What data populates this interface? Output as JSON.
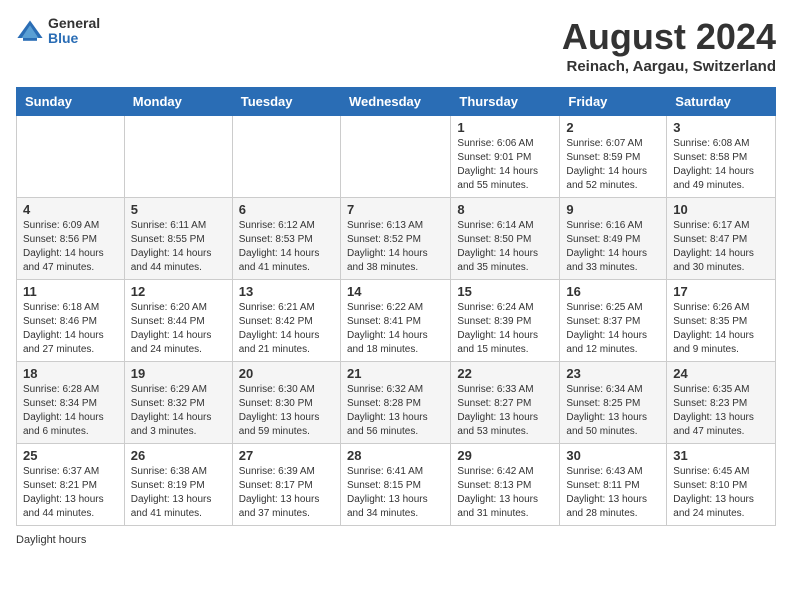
{
  "header": {
    "logo_general": "General",
    "logo_blue": "Blue",
    "month_year": "August 2024",
    "location": "Reinach, Aargau, Switzerland"
  },
  "weekdays": [
    "Sunday",
    "Monday",
    "Tuesday",
    "Wednesday",
    "Thursday",
    "Friday",
    "Saturday"
  ],
  "weeks": [
    [
      {
        "day": "",
        "info": ""
      },
      {
        "day": "",
        "info": ""
      },
      {
        "day": "",
        "info": ""
      },
      {
        "day": "",
        "info": ""
      },
      {
        "day": "1",
        "info": "Sunrise: 6:06 AM\nSunset: 9:01 PM\nDaylight: 14 hours\nand 55 minutes."
      },
      {
        "day": "2",
        "info": "Sunrise: 6:07 AM\nSunset: 8:59 PM\nDaylight: 14 hours\nand 52 minutes."
      },
      {
        "day": "3",
        "info": "Sunrise: 6:08 AM\nSunset: 8:58 PM\nDaylight: 14 hours\nand 49 minutes."
      }
    ],
    [
      {
        "day": "4",
        "info": "Sunrise: 6:09 AM\nSunset: 8:56 PM\nDaylight: 14 hours\nand 47 minutes."
      },
      {
        "day": "5",
        "info": "Sunrise: 6:11 AM\nSunset: 8:55 PM\nDaylight: 14 hours\nand 44 minutes."
      },
      {
        "day": "6",
        "info": "Sunrise: 6:12 AM\nSunset: 8:53 PM\nDaylight: 14 hours\nand 41 minutes."
      },
      {
        "day": "7",
        "info": "Sunrise: 6:13 AM\nSunset: 8:52 PM\nDaylight: 14 hours\nand 38 minutes."
      },
      {
        "day": "8",
        "info": "Sunrise: 6:14 AM\nSunset: 8:50 PM\nDaylight: 14 hours\nand 35 minutes."
      },
      {
        "day": "9",
        "info": "Sunrise: 6:16 AM\nSunset: 8:49 PM\nDaylight: 14 hours\nand 33 minutes."
      },
      {
        "day": "10",
        "info": "Sunrise: 6:17 AM\nSunset: 8:47 PM\nDaylight: 14 hours\nand 30 minutes."
      }
    ],
    [
      {
        "day": "11",
        "info": "Sunrise: 6:18 AM\nSunset: 8:46 PM\nDaylight: 14 hours\nand 27 minutes."
      },
      {
        "day": "12",
        "info": "Sunrise: 6:20 AM\nSunset: 8:44 PM\nDaylight: 14 hours\nand 24 minutes."
      },
      {
        "day": "13",
        "info": "Sunrise: 6:21 AM\nSunset: 8:42 PM\nDaylight: 14 hours\nand 21 minutes."
      },
      {
        "day": "14",
        "info": "Sunrise: 6:22 AM\nSunset: 8:41 PM\nDaylight: 14 hours\nand 18 minutes."
      },
      {
        "day": "15",
        "info": "Sunrise: 6:24 AM\nSunset: 8:39 PM\nDaylight: 14 hours\nand 15 minutes."
      },
      {
        "day": "16",
        "info": "Sunrise: 6:25 AM\nSunset: 8:37 PM\nDaylight: 14 hours\nand 12 minutes."
      },
      {
        "day": "17",
        "info": "Sunrise: 6:26 AM\nSunset: 8:35 PM\nDaylight: 14 hours\nand 9 minutes."
      }
    ],
    [
      {
        "day": "18",
        "info": "Sunrise: 6:28 AM\nSunset: 8:34 PM\nDaylight: 14 hours\nand 6 minutes."
      },
      {
        "day": "19",
        "info": "Sunrise: 6:29 AM\nSunset: 8:32 PM\nDaylight: 14 hours\nand 3 minutes."
      },
      {
        "day": "20",
        "info": "Sunrise: 6:30 AM\nSunset: 8:30 PM\nDaylight: 13 hours\nand 59 minutes."
      },
      {
        "day": "21",
        "info": "Sunrise: 6:32 AM\nSunset: 8:28 PM\nDaylight: 13 hours\nand 56 minutes."
      },
      {
        "day": "22",
        "info": "Sunrise: 6:33 AM\nSunset: 8:27 PM\nDaylight: 13 hours\nand 53 minutes."
      },
      {
        "day": "23",
        "info": "Sunrise: 6:34 AM\nSunset: 8:25 PM\nDaylight: 13 hours\nand 50 minutes."
      },
      {
        "day": "24",
        "info": "Sunrise: 6:35 AM\nSunset: 8:23 PM\nDaylight: 13 hours\nand 47 minutes."
      }
    ],
    [
      {
        "day": "25",
        "info": "Sunrise: 6:37 AM\nSunset: 8:21 PM\nDaylight: 13 hours\nand 44 minutes."
      },
      {
        "day": "26",
        "info": "Sunrise: 6:38 AM\nSunset: 8:19 PM\nDaylight: 13 hours\nand 41 minutes."
      },
      {
        "day": "27",
        "info": "Sunrise: 6:39 AM\nSunset: 8:17 PM\nDaylight: 13 hours\nand 37 minutes."
      },
      {
        "day": "28",
        "info": "Sunrise: 6:41 AM\nSunset: 8:15 PM\nDaylight: 13 hours\nand 34 minutes."
      },
      {
        "day": "29",
        "info": "Sunrise: 6:42 AM\nSunset: 8:13 PM\nDaylight: 13 hours\nand 31 minutes."
      },
      {
        "day": "30",
        "info": "Sunrise: 6:43 AM\nSunset: 8:11 PM\nDaylight: 13 hours\nand 28 minutes."
      },
      {
        "day": "31",
        "info": "Sunrise: 6:45 AM\nSunset: 8:10 PM\nDaylight: 13 hours\nand 24 minutes."
      }
    ]
  ],
  "footer": {
    "note": "Daylight hours"
  }
}
